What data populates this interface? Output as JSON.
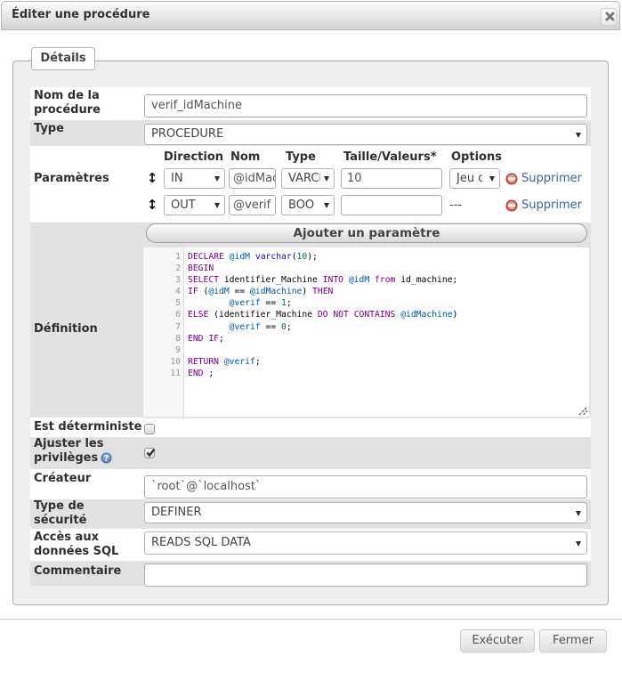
{
  "dialog": {
    "title": "Éditer une procédure"
  },
  "tab": {
    "label": "Détails"
  },
  "form": {
    "name": {
      "label": "Nom de la procédure",
      "value": "verif_idMachine"
    },
    "type": {
      "label": "Type",
      "value": "PROCEDURE"
    },
    "params": {
      "label": "Paramètres",
      "headers": {
        "direction": "Direction",
        "name": "Nom",
        "type": "Type",
        "length": "Taille/Valeurs*",
        "options": "Options"
      },
      "rows": [
        {
          "direction": "IN",
          "name": "@idMachine",
          "type": "VARCHAR",
          "length": "10",
          "options": "Jeu de caractères",
          "has_options_select": true,
          "remove_label": "Supprimer"
        },
        {
          "direction": "OUT",
          "name": "@verif",
          "type": "BOOLEAN",
          "length": "",
          "options": "---",
          "has_options_select": false,
          "remove_label": "Supprimer"
        }
      ],
      "add_button": "Ajouter un paramètre"
    },
    "definition": {
      "label": "Définition",
      "code_lines": [
        [
          [
            "k",
            "DECLARE"
          ],
          [
            "t",
            " "
          ],
          [
            "v",
            "@idM"
          ],
          [
            "t",
            " "
          ],
          [
            "b",
            "varchar"
          ],
          [
            "t",
            "("
          ],
          [
            "n",
            "10"
          ],
          [
            "t",
            ");"
          ]
        ],
        [
          [
            "k",
            "BEGIN"
          ]
        ],
        [
          [
            "k",
            "SELECT"
          ],
          [
            "t",
            " identifier_Machine "
          ],
          [
            "k",
            "INTO"
          ],
          [
            "t",
            " "
          ],
          [
            "v",
            "@idM"
          ],
          [
            "t",
            " "
          ],
          [
            "k",
            "from"
          ],
          [
            "t",
            " id_machine;"
          ]
        ],
        [
          [
            "k",
            "IF"
          ],
          [
            "t",
            " ("
          ],
          [
            "v",
            "@idM"
          ],
          [
            "t",
            " == "
          ],
          [
            "v",
            "@idMachine"
          ],
          [
            "t",
            ") "
          ],
          [
            "k",
            "THEN"
          ]
        ],
        [
          [
            "t",
            "        "
          ],
          [
            "v",
            "@verif"
          ],
          [
            "t",
            " == "
          ],
          [
            "n",
            "1"
          ],
          [
            "t",
            ";"
          ]
        ],
        [
          [
            "k",
            "ELSE"
          ],
          [
            "t",
            " (identifier_Machine "
          ],
          [
            "k",
            "DO"
          ],
          [
            "t",
            " "
          ],
          [
            "k",
            "NOT"
          ],
          [
            "t",
            " "
          ],
          [
            "k",
            "CONTAINS"
          ],
          [
            "t",
            " "
          ],
          [
            "v",
            "@idMachine"
          ],
          [
            "t",
            ")"
          ]
        ],
        [
          [
            "t",
            "        "
          ],
          [
            "v",
            "@verif"
          ],
          [
            "t",
            " == "
          ],
          [
            "n",
            "0"
          ],
          [
            "t",
            ";"
          ]
        ],
        [
          [
            "k",
            "END"
          ],
          [
            "t",
            " "
          ],
          [
            "k",
            "IF"
          ],
          [
            "t",
            ";"
          ]
        ],
        [],
        [
          [
            "k",
            "RETURN"
          ],
          [
            "t",
            " "
          ],
          [
            "v",
            "@verif"
          ],
          [
            "t",
            ";"
          ]
        ],
        [
          [
            "k",
            "END"
          ],
          [
            "t",
            " ;"
          ]
        ]
      ]
    },
    "deterministic": {
      "label": "Est déterministe",
      "checked": false
    },
    "privileges": {
      "label": "Ajuster les privilèges",
      "checked": true
    },
    "creator": {
      "label": "Créateur",
      "value": "`root`@`localhost`"
    },
    "security": {
      "label": "Type de sécurité",
      "value": "DEFINER"
    },
    "sql_access": {
      "label": "Accès aux données SQL",
      "value": "READS SQL DATA"
    },
    "comment": {
      "label": "Commentaire",
      "value": ""
    }
  },
  "buttons": {
    "execute": "Exécuter",
    "close": "Fermer"
  },
  "icons": {
    "close": "x-cross",
    "drag_handle": "↕",
    "select_arrow": "▾",
    "remove": "red-minus-circle",
    "help": "blue-question-circle",
    "checkmark": "✔",
    "resize_grip": "diagonal-dashes"
  },
  "colors": {
    "link": "#35679d",
    "remove_icon_red": "#dd5042",
    "help_icon_blue": "#41699f",
    "row_stripe_gray": "#e2e2e2",
    "fieldset_bg": "#efefef",
    "code_keyword": "#770088",
    "code_variable": "#0055aa",
    "code_builtin": "#3300aa",
    "code_number": "#116644"
  }
}
